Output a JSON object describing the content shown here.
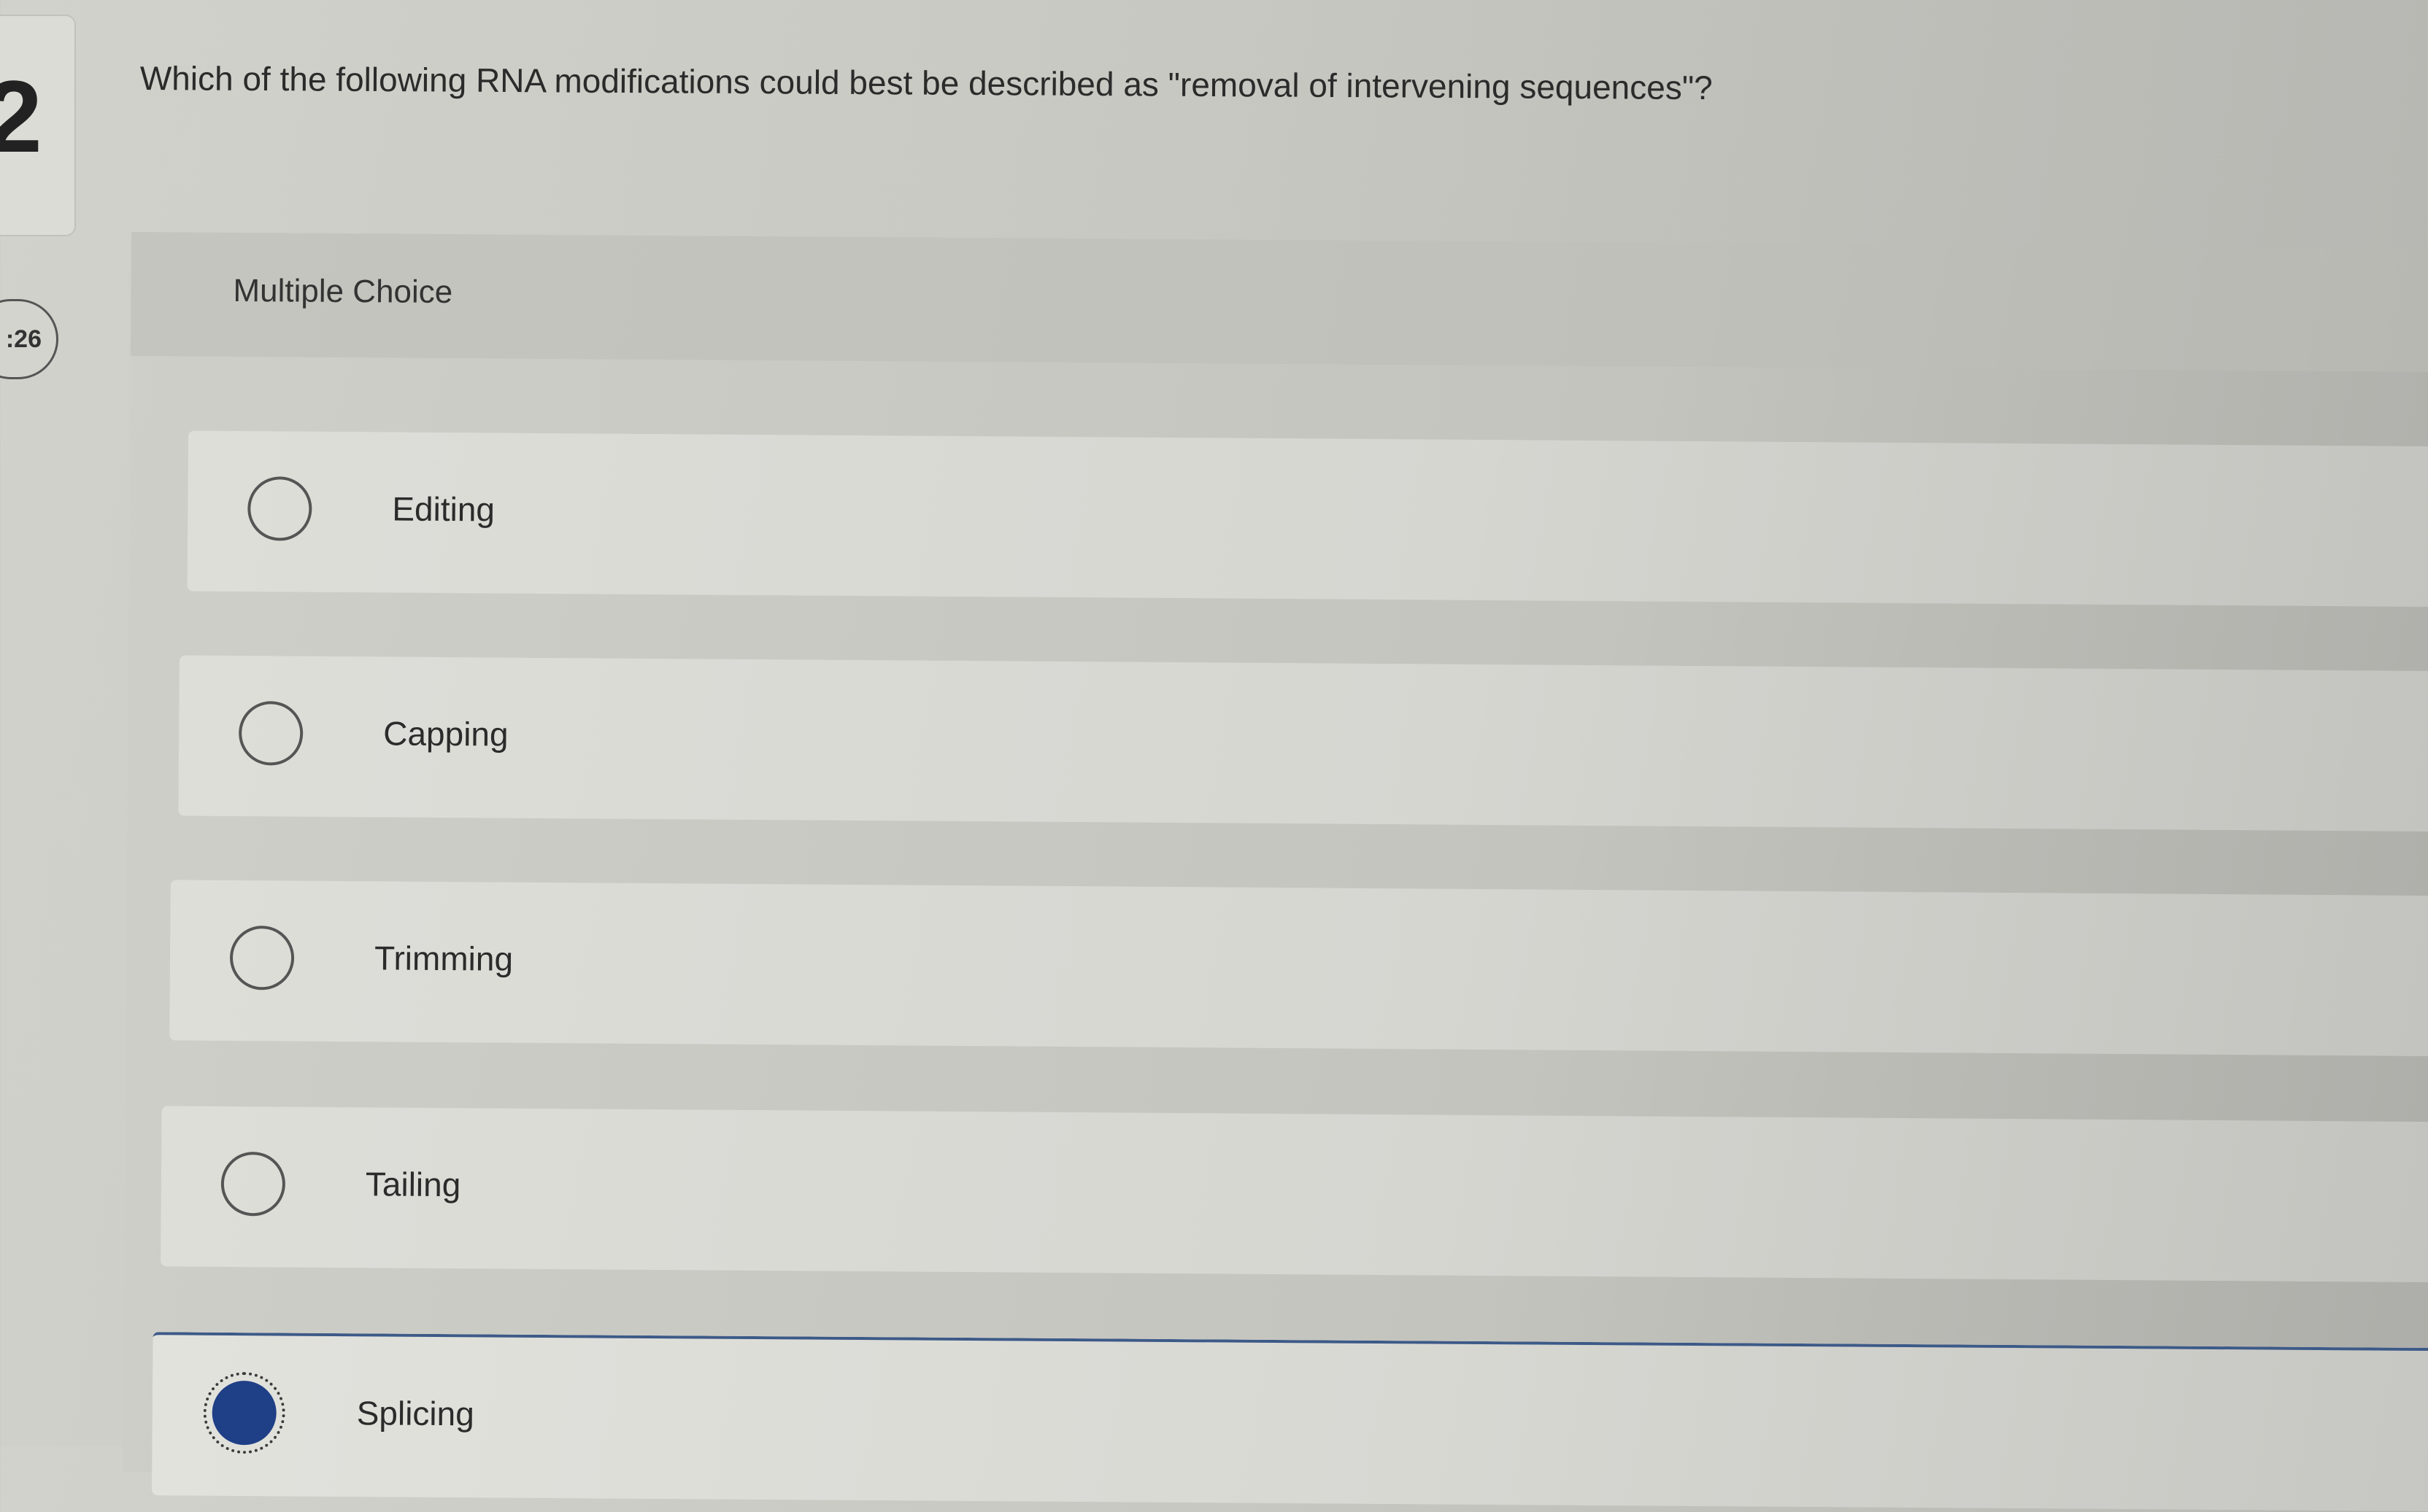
{
  "question": {
    "number": "2",
    "text": "Which of the following RNA modifications could best be described as \"removal of intervening sequences\"?"
  },
  "timer": {
    "text": ":26"
  },
  "choices": {
    "header": "Multiple Choice",
    "options": [
      {
        "label": "Editing",
        "selected": false
      },
      {
        "label": "Capping",
        "selected": false
      },
      {
        "label": "Trimming",
        "selected": false
      },
      {
        "label": "Tailing",
        "selected": false
      },
      {
        "label": "Splicing",
        "selected": true
      }
    ]
  },
  "colors": {
    "selected_radio": "#1f3f86",
    "selected_border": "#3c5a88"
  }
}
